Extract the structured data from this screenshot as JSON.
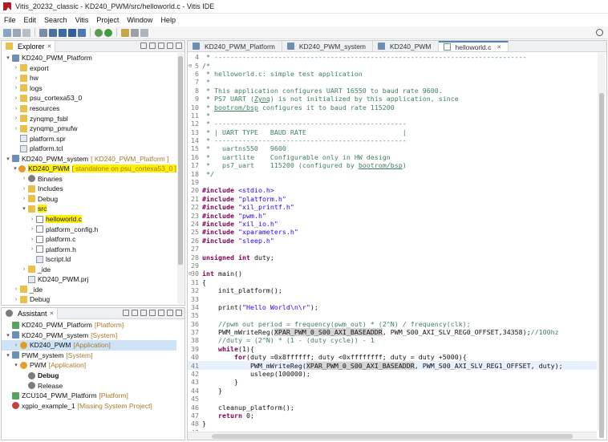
{
  "window": {
    "title": "Vitis_20232_classic - KD240_PWM/src/helloworld.c - Vitis IDE"
  },
  "menu": [
    "File",
    "Edit",
    "Search",
    "Vitis",
    "Project",
    "Window",
    "Help"
  ],
  "explorer": {
    "tab_label": "Explorer",
    "items": [
      {
        "depth": 0,
        "twisty": "▾",
        "icon": "project",
        "label": "KD240_PWM_Platform",
        "note": ""
      },
      {
        "depth": 1,
        "twisty": "›",
        "icon": "folder",
        "label": "export",
        "note": ""
      },
      {
        "depth": 1,
        "twisty": "›",
        "icon": "folder",
        "label": "hw",
        "note": ""
      },
      {
        "depth": 1,
        "twisty": "›",
        "icon": "folder",
        "label": "logs",
        "note": ""
      },
      {
        "depth": 1,
        "twisty": "›",
        "icon": "folder",
        "label": "psu_cortexa53_0",
        "note": ""
      },
      {
        "depth": 1,
        "twisty": "›",
        "icon": "folder",
        "label": "resources",
        "note": ""
      },
      {
        "depth": 1,
        "twisty": "›",
        "icon": "folder",
        "label": "zynqmp_fsbl",
        "note": ""
      },
      {
        "depth": 1,
        "twisty": "›",
        "icon": "folder",
        "label": "zynqmp_pmufw",
        "note": ""
      },
      {
        "depth": 1,
        "twisty": "",
        "icon": "file-x",
        "label": "platform.spr",
        "note": ""
      },
      {
        "depth": 1,
        "twisty": "",
        "icon": "file-x",
        "label": "platform.tcl",
        "note": ""
      },
      {
        "depth": 0,
        "twisty": "▾",
        "icon": "project",
        "label": "KD240_PWM_system",
        "note": "[ KD240_PWM_Platform ]"
      },
      {
        "depth": 1,
        "twisty": "▾",
        "icon": "app-icon",
        "label": "KD240_PWM",
        "note": "[ standalone on psu_cortexa53_0 ]",
        "highlight": true
      },
      {
        "depth": 2,
        "twisty": "›",
        "icon": "gear",
        "label": "Binaries",
        "note": ""
      },
      {
        "depth": 2,
        "twisty": "›",
        "icon": "folder",
        "label": "Includes",
        "note": ""
      },
      {
        "depth": 2,
        "twisty": "›",
        "icon": "folder",
        "label": "Debug",
        "note": ""
      },
      {
        "depth": 2,
        "twisty": "▾",
        "icon": "folder",
        "label": "src",
        "note": "",
        "highlight": true
      },
      {
        "depth": 3,
        "twisty": "›",
        "icon": "file-c",
        "label": "helloworld.c",
        "note": "",
        "highlight": true
      },
      {
        "depth": 3,
        "twisty": "›",
        "icon": "file-c",
        "label": "platform_config.h",
        "note": ""
      },
      {
        "depth": 3,
        "twisty": "›",
        "icon": "file-c",
        "label": "platform.c",
        "note": ""
      },
      {
        "depth": 3,
        "twisty": "›",
        "icon": "file-h",
        "label": "platform.h",
        "note": ""
      },
      {
        "depth": 3,
        "twisty": "",
        "icon": "file-x",
        "label": "lscript.ld",
        "note": ""
      },
      {
        "depth": 2,
        "twisty": "›",
        "icon": "folder",
        "label": "_ide",
        "note": ""
      },
      {
        "depth": 2,
        "twisty": "",
        "icon": "file-x",
        "label": "KD240_PWM.prj",
        "note": ""
      },
      {
        "depth": 1,
        "twisty": "›",
        "icon": "folder",
        "label": "_ide",
        "note": ""
      },
      {
        "depth": 1,
        "twisty": "›",
        "icon": "folder",
        "label": "Debug",
        "note": ""
      }
    ]
  },
  "assistant": {
    "tab_label": "Assistant",
    "items": [
      {
        "depth": 0,
        "twisty": "",
        "icon": "green-sq",
        "label": "KD240_PWM_Platform",
        "note": "[Platform]"
      },
      {
        "depth": 0,
        "twisty": "▾",
        "icon": "project",
        "label": "KD240_PWM_system",
        "note": "[System]"
      },
      {
        "depth": 1,
        "twisty": "›",
        "icon": "app-icon",
        "label": "KD240_PWM",
        "note": "[Application]",
        "selected": true
      },
      {
        "depth": 0,
        "twisty": "▾",
        "icon": "project",
        "label": "PWM_system",
        "note": "[System]"
      },
      {
        "depth": 1,
        "twisty": "▾",
        "icon": "app-icon",
        "label": "PWM",
        "note": "[Application]"
      },
      {
        "depth": 2,
        "twisty": "",
        "icon": "gear",
        "label": "Debug",
        "note": "",
        "bold": true
      },
      {
        "depth": 2,
        "twisty": "",
        "icon": "gear",
        "label": "Release",
        "note": ""
      },
      {
        "depth": 0,
        "twisty": "",
        "icon": "green-sq",
        "label": "ZCU104_PWM_Platform",
        "note": "[Platform]"
      },
      {
        "depth": 0,
        "twisty": "",
        "icon": "red-ball",
        "label": "xgpio_example_1",
        "note": "[Missing System Project]"
      }
    ]
  },
  "editor": {
    "tabs": [
      {
        "label": "KD240_PWM_Platform",
        "active": false
      },
      {
        "label": "KD240_PWM_system",
        "active": false
      },
      {
        "label": "KD240_PWM",
        "active": false
      },
      {
        "label": "helloworld.c",
        "active": true
      }
    ],
    "lines": [
      {
        "n": "4",
        "t": " * ------------------------------------------------------------------------------",
        "c": "comment"
      },
      {
        "n": "5",
        "t": "/*",
        "c": "comment",
        "fold": "⊖"
      },
      {
        "n": "6",
        "t": " * helloworld.c: simple test application",
        "c": "comment"
      },
      {
        "n": "7",
        "t": " *",
        "c": "comment"
      },
      {
        "n": "8",
        "t": " * This application configures UART 16550 to baud rate 9600.",
        "c": "comment"
      },
      {
        "n": "9",
        "t": " * PS7 UART (Zynq) is not initialized by this application, since",
        "c": "comment"
      },
      {
        "n": "10",
        "t": " * bootrom/bsp configures it to baud rate 115200",
        "c": "comment"
      },
      {
        "n": "11",
        "t": " *",
        "c": "comment"
      },
      {
        "n": "12",
        "t": " * ------------------------------------------------",
        "c": "comment"
      },
      {
        "n": "13",
        "t": " * | UART TYPE   BAUD RATE                        |",
        "c": "comment"
      },
      {
        "n": "14",
        "t": " * ------------------------------------------------",
        "c": "comment"
      },
      {
        "n": "15",
        "t": " *   uartns550   9600",
        "c": "comment"
      },
      {
        "n": "16",
        "t": " *   uartlite    Configurable only in HW design",
        "c": "comment"
      },
      {
        "n": "17",
        "t": " *   ps7_uart    115200 (configured by bootrom/bsp)",
        "c": "comment"
      },
      {
        "n": "18",
        "t": " */",
        "c": "comment"
      },
      {
        "n": "19",
        "t": "",
        "c": "code"
      },
      {
        "n": "20",
        "t": "#include <stdio.h>",
        "c": "inc"
      },
      {
        "n": "21",
        "t": "#include \"platform.h\"",
        "c": "inc"
      },
      {
        "n": "22",
        "t": "#include \"xil_printf.h\"",
        "c": "inc"
      },
      {
        "n": "23",
        "t": "#include \"pwm.h\"",
        "c": "inc"
      },
      {
        "n": "24",
        "t": "#include \"xil_io.h\"",
        "c": "inc"
      },
      {
        "n": "25",
        "t": "#include \"xparameters.h\"",
        "c": "inc"
      },
      {
        "n": "26",
        "t": "#include \"sleep.h\"",
        "c": "inc"
      },
      {
        "n": "27",
        "t": "",
        "c": "code"
      },
      {
        "n": "28",
        "t": "unsigned int duty;",
        "c": "decl"
      },
      {
        "n": "29",
        "t": "",
        "c": "code"
      },
      {
        "n": "30",
        "t": "int main()",
        "c": "main",
        "fold": "⊖"
      },
      {
        "n": "31",
        "t": "{",
        "c": "code"
      },
      {
        "n": "32",
        "t": "    init_platform();",
        "c": "code"
      },
      {
        "n": "33",
        "t": "",
        "c": "code"
      },
      {
        "n": "34",
        "t": "    print(\"Hello World\\n\\r\");",
        "c": "print"
      },
      {
        "n": "35",
        "t": "",
        "c": "code"
      },
      {
        "n": "36",
        "t": "    //pwm out period = frequency(pwm_out) * (2^N) / frequency(clk);",
        "c": "comment"
      },
      {
        "n": "37",
        "t": "    PWM_mWriteReg(XPAR_PWM_0_S00_AXI_BASEADDR, PWM_S00_AXI_SLV_REG0_OFFSET,34358);//100hz",
        "c": "reg0"
      },
      {
        "n": "38",
        "t": "    //duty = (2^N) * (1 - (duty cycle)) - 1",
        "c": "comment"
      },
      {
        "n": "39",
        "t": "    while(1){",
        "c": "while"
      },
      {
        "n": "40",
        "t": "        for(duty =0x8ffffff; duty <0xffffffff; duty = duty +5000){",
        "c": "for"
      },
      {
        "n": "41",
        "t": "            PWM_mWriteReg(XPAR_PWM_0_S00_AXI_BASEADDR, PWM_S00_AXI_SLV_REG1_OFFSET, duty);",
        "c": "reg1",
        "current": true
      },
      {
        "n": "42",
        "t": "            usleep(100000);",
        "c": "code"
      },
      {
        "n": "43",
        "t": "        }",
        "c": "code"
      },
      {
        "n": "44",
        "t": "    }",
        "c": "code"
      },
      {
        "n": "45",
        "t": "",
        "c": "code"
      },
      {
        "n": "46",
        "t": "    cleanup_platform();",
        "c": "code"
      },
      {
        "n": "47",
        "t": "    return 0;",
        "c": "return"
      },
      {
        "n": "48",
        "t": "}",
        "c": "code"
      },
      {
        "n": "49",
        "t": "",
        "c": "code"
      }
    ]
  },
  "colors": {
    "highlight": "#fff200",
    "comment": "#3f7f5f",
    "keyword": "#7f0055",
    "string": "#2a00ff"
  }
}
